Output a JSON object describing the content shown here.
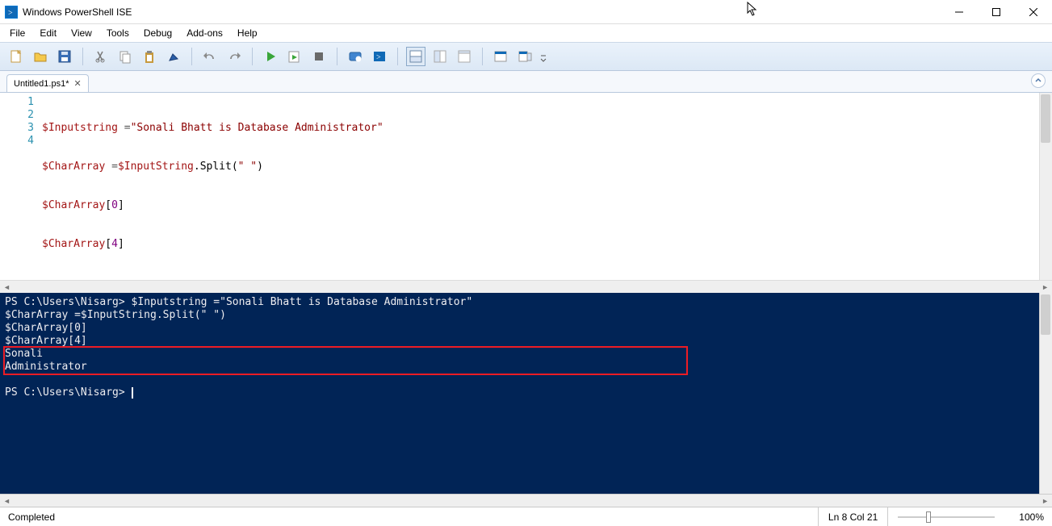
{
  "window": {
    "title": "Windows PowerShell ISE"
  },
  "menu": [
    "File",
    "Edit",
    "View",
    "Tools",
    "Debug",
    "Add-ons",
    "Help"
  ],
  "tabs": [
    {
      "label": "Untitled1.ps1*"
    }
  ],
  "editor": {
    "line_numbers": [
      "1",
      "2",
      "3",
      "4"
    ],
    "lines": [
      {
        "var": "$Inputstring",
        "eq": " =",
        "str": "\"Sonali Bhatt is Database Administrator\""
      },
      {
        "var": "$CharArray",
        "eq": " =",
        "var2": "$InputString",
        "dot": ".",
        "method": "Split(",
        "arg": "\" \"",
        "close": ")"
      },
      {
        "var": "$CharArray",
        "br": "[",
        "idx": "0",
        "br2": "]"
      },
      {
        "var": "$CharArray",
        "br": "[",
        "idx": "4",
        "br2": "]"
      }
    ]
  },
  "console": {
    "prompt1": "PS C:\\Users\\Nisarg> ",
    "cmd1": "$Inputstring =\"Sonali Bhatt is Database Administrator\"",
    "line2": "$CharArray =$InputString.Split(\" \")",
    "line3": "$CharArray[0]",
    "line4": "$CharArray[4]",
    "out1": "Sonali",
    "out2": "Administrator",
    "prompt2": "PS C:\\Users\\Nisarg> "
  },
  "status": {
    "left": "Completed",
    "position": "Ln 8  Col 21",
    "zoom": "100%"
  }
}
